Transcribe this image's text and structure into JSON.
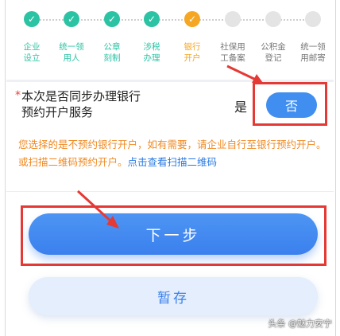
{
  "steps": [
    {
      "label": "企业\n设立",
      "state": "done",
      "color": "#2cc3a4"
    },
    {
      "label": "统一领\n用人",
      "state": "done",
      "color": "#2cc3a4"
    },
    {
      "label": "公章\n刻制",
      "state": "done",
      "color": "#2cc3a4"
    },
    {
      "label": "涉税\n办理",
      "state": "done",
      "color": "#2cc3a4"
    },
    {
      "label": "银行\n开户",
      "state": "current",
      "color": "#f5a623"
    },
    {
      "label": "社保用\n工备案",
      "state": "todo",
      "color": "#888888"
    },
    {
      "label": "公积金\n登记",
      "state": "todo",
      "color": "#888888"
    },
    {
      "label": "统一领\n用邮寄",
      "state": "todo",
      "color": "#888888"
    }
  ],
  "question": {
    "required_mark": "*",
    "text": "本次是否同步办理银行预约开户服务",
    "yes_label": "是",
    "no_label": "否",
    "selected": "否"
  },
  "notice": {
    "text": "您选择的是不预约银行开户，如有需要，请企业自行至银行预约开户。或扫描二维码预约开户。",
    "link": "点击查看扫描二维码"
  },
  "buttons": {
    "next": "下一步",
    "save": "暂存"
  },
  "watermark": "头条 @魅力安宁",
  "colors": {
    "accent": "#3b80ee",
    "done": "#2cc3a4",
    "current": "#f5a623",
    "warning": "#f08a24",
    "annotation": "#e53935"
  }
}
